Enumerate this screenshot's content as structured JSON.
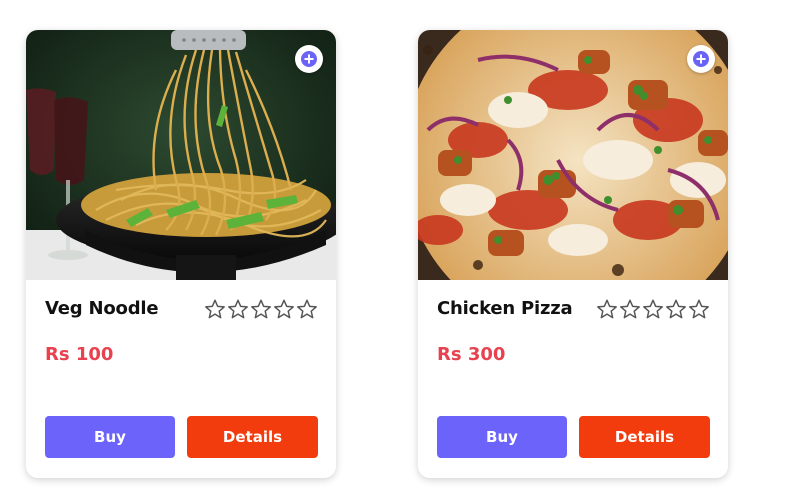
{
  "products": [
    {
      "name": "Veg Noodle",
      "price": "Rs 100",
      "rating": 0,
      "rating_max": 5,
      "buy_label": "Buy",
      "details_label": "Details",
      "image": "noodles-photo"
    },
    {
      "name": "Chicken Pizza",
      "price": "Rs 300",
      "rating": 0,
      "rating_max": 5,
      "buy_label": "Buy",
      "details_label": "Details",
      "image": "pizza-photo"
    }
  ],
  "icons": {
    "add": "add-circle-icon",
    "star": "star-outline-icon"
  },
  "colors": {
    "buy_button": "#6b63fa",
    "details_button": "#f23c0d",
    "price": "#e8414f",
    "add_icon": "#6b63f5",
    "star_outline": "#555555"
  }
}
